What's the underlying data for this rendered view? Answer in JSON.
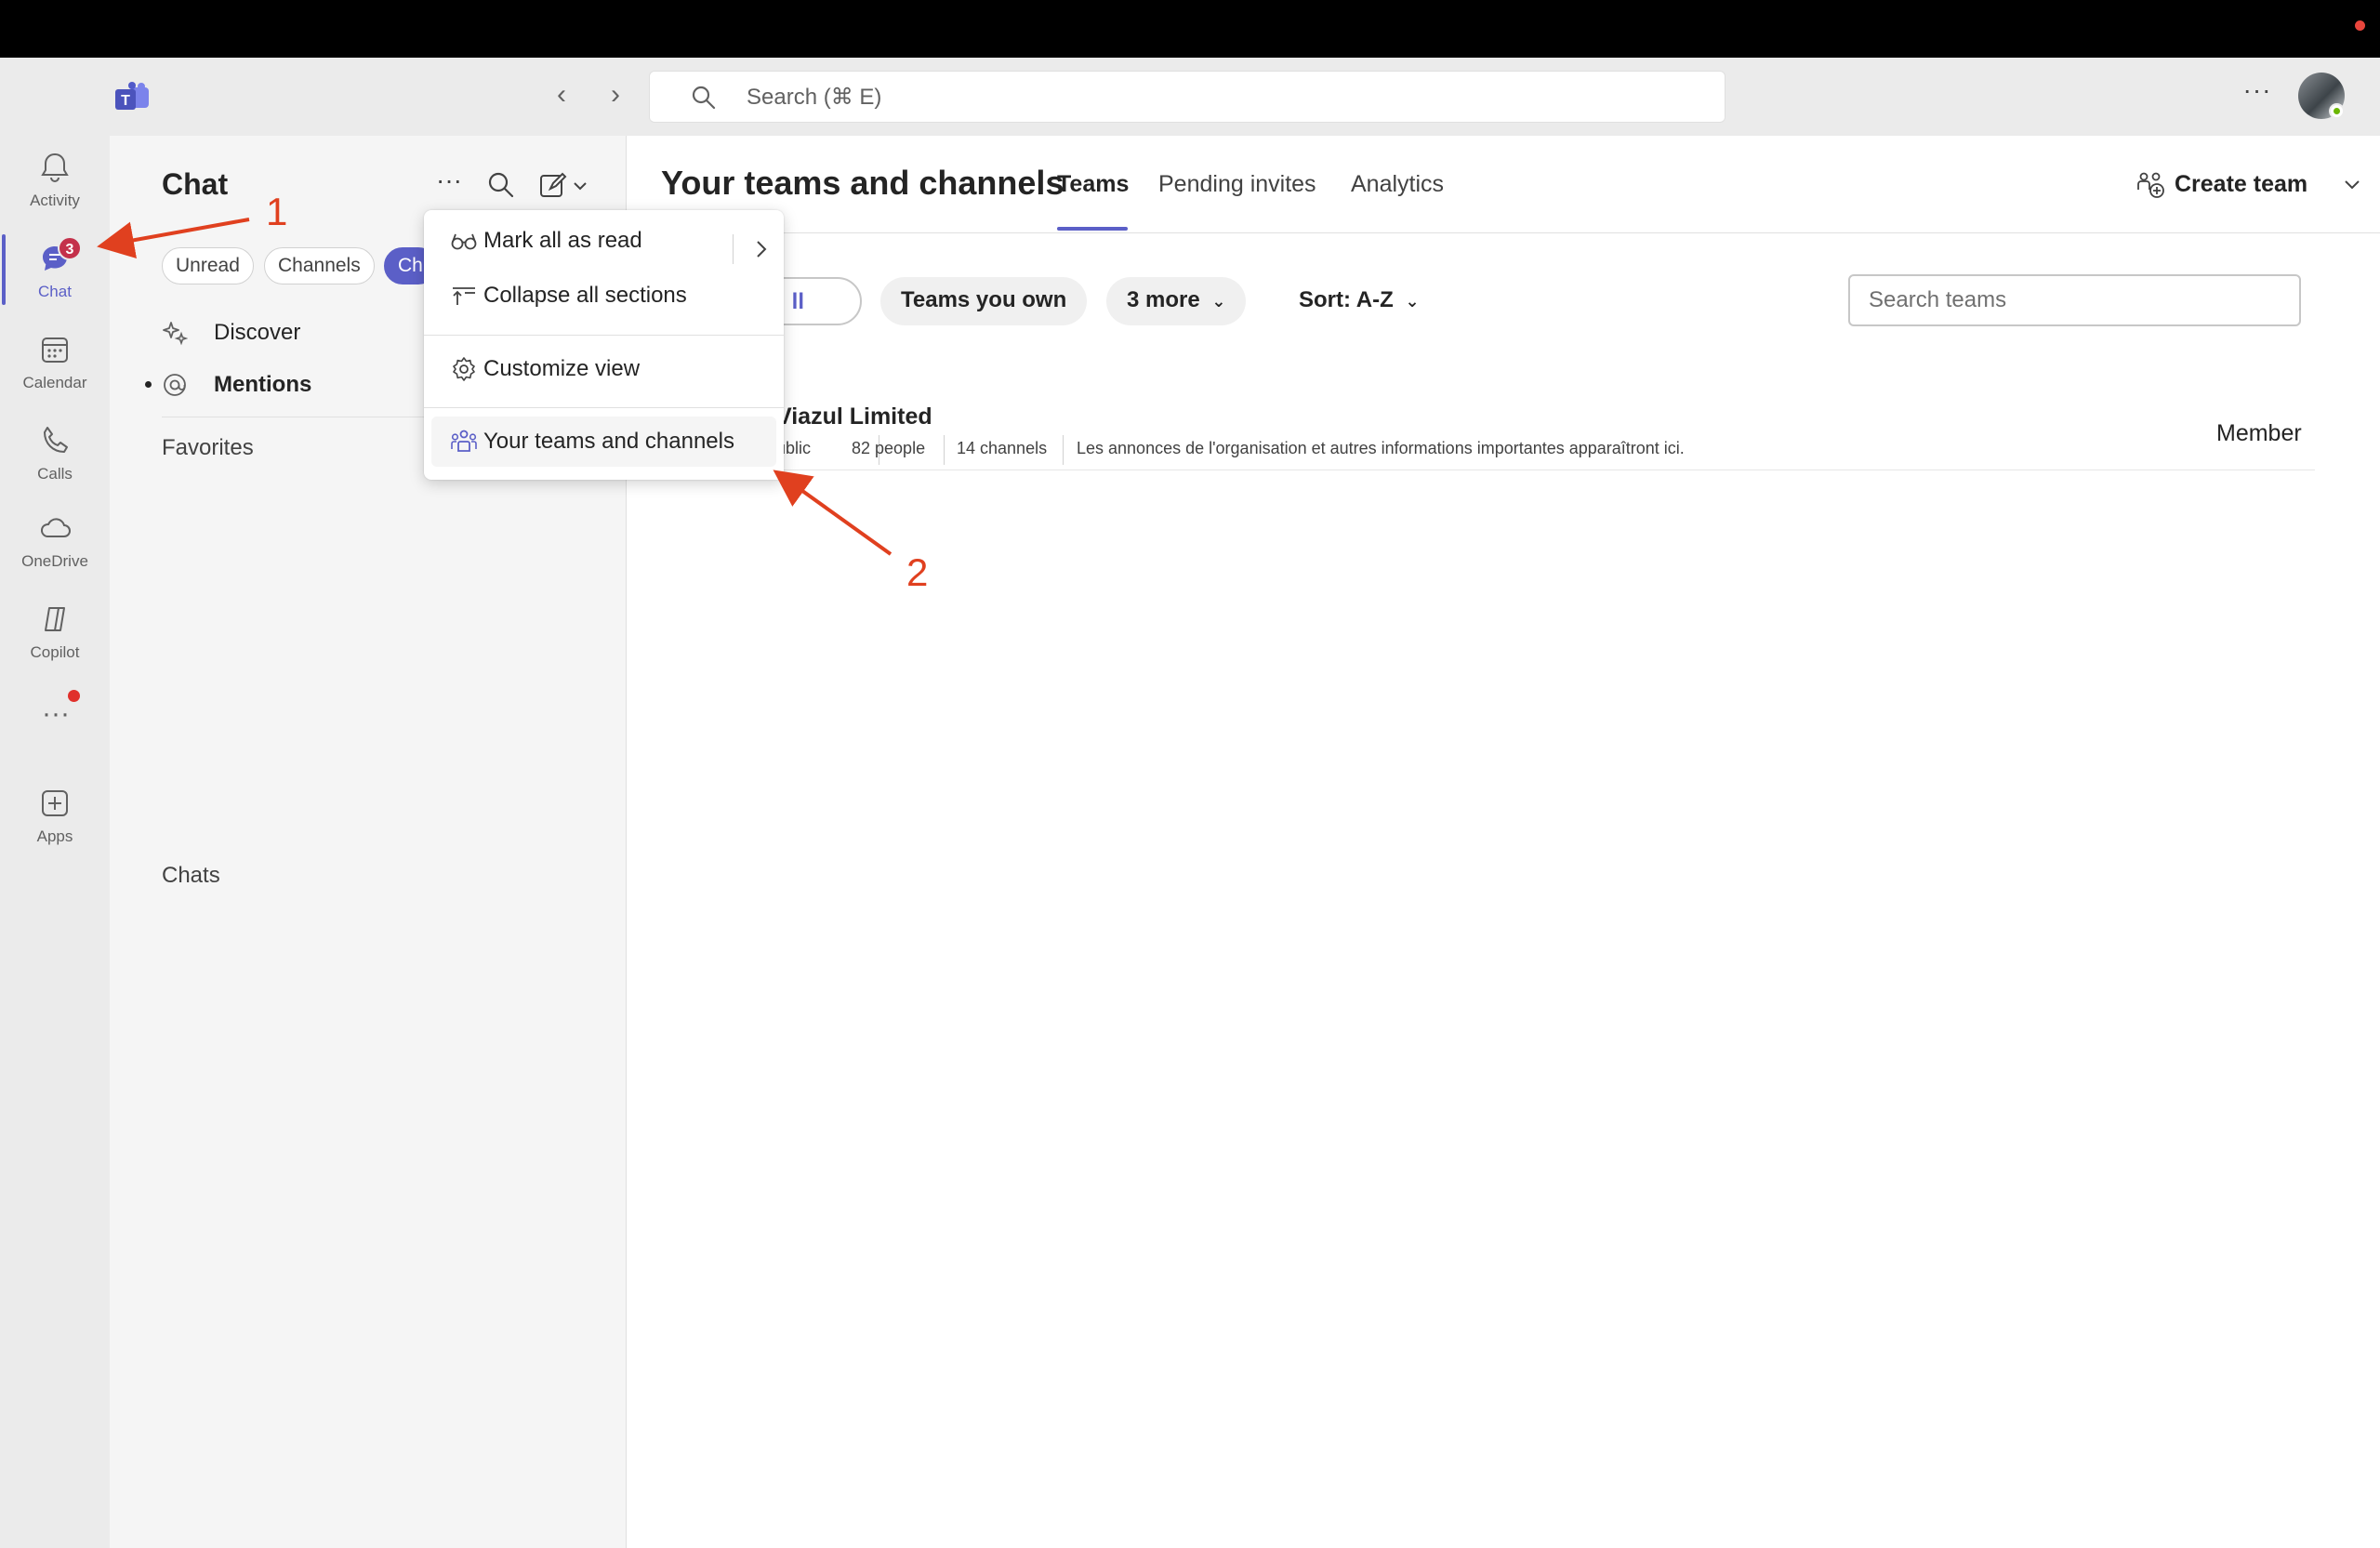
{
  "colors": {
    "accent": "#5b5fc7",
    "badge": "#c4314b",
    "annotation": "#e0401f",
    "rail_bg": "#ebebeb"
  },
  "titlebar": {
    "search_placeholder": "Search (⌘ E)"
  },
  "rail": {
    "items": [
      {
        "label": "Activity",
        "icon": "bell-icon"
      },
      {
        "label": "Chat",
        "icon": "chat-icon",
        "badge": "3"
      },
      {
        "label": "Calendar",
        "icon": "calendar-icon"
      },
      {
        "label": "Calls",
        "icon": "phone-icon"
      },
      {
        "label": "OneDrive",
        "icon": "cloud-icon"
      },
      {
        "label": "Copilot",
        "icon": "copilot-icon"
      },
      {
        "label": "Apps",
        "icon": "add-app-icon"
      }
    ]
  },
  "chatpane": {
    "title": "Chat",
    "filters": [
      "Unread",
      "Channels",
      "Ch"
    ],
    "rows": [
      {
        "label": "Discover",
        "icon": "sparkle-icon"
      },
      {
        "label": "Mentions",
        "icon": "at-icon"
      }
    ],
    "sections": {
      "favorites": "Favorites",
      "chats": "Chats"
    }
  },
  "menu": {
    "items": [
      {
        "label": "Mark all as read",
        "icon": "glasses-icon"
      },
      {
        "label": "Collapse all sections",
        "icon": "collapse-icon"
      },
      {
        "label": "Customize view",
        "icon": "gear-icon"
      },
      {
        "label": "Your teams and channels",
        "icon": "teams-icon"
      }
    ]
  },
  "main": {
    "title": "Your teams and channels",
    "tabs": [
      "Teams",
      "Pending invites",
      "Analytics"
    ],
    "create_team": "Create team",
    "filters": {
      "all": "ll",
      "own": "Teams you own",
      "more": "3 more",
      "sort": "Sort: A-Z"
    },
    "search_placeholder": "Search teams",
    "team": {
      "name": "Viazul Limited",
      "visibility": "ublic",
      "people": "82 people",
      "channels": "14 channels",
      "description": "Les annonces de l'organisation et autres informations importantes apparaîtront ici.",
      "role": "Member"
    }
  },
  "annotations": {
    "one": "1",
    "two": "2"
  }
}
